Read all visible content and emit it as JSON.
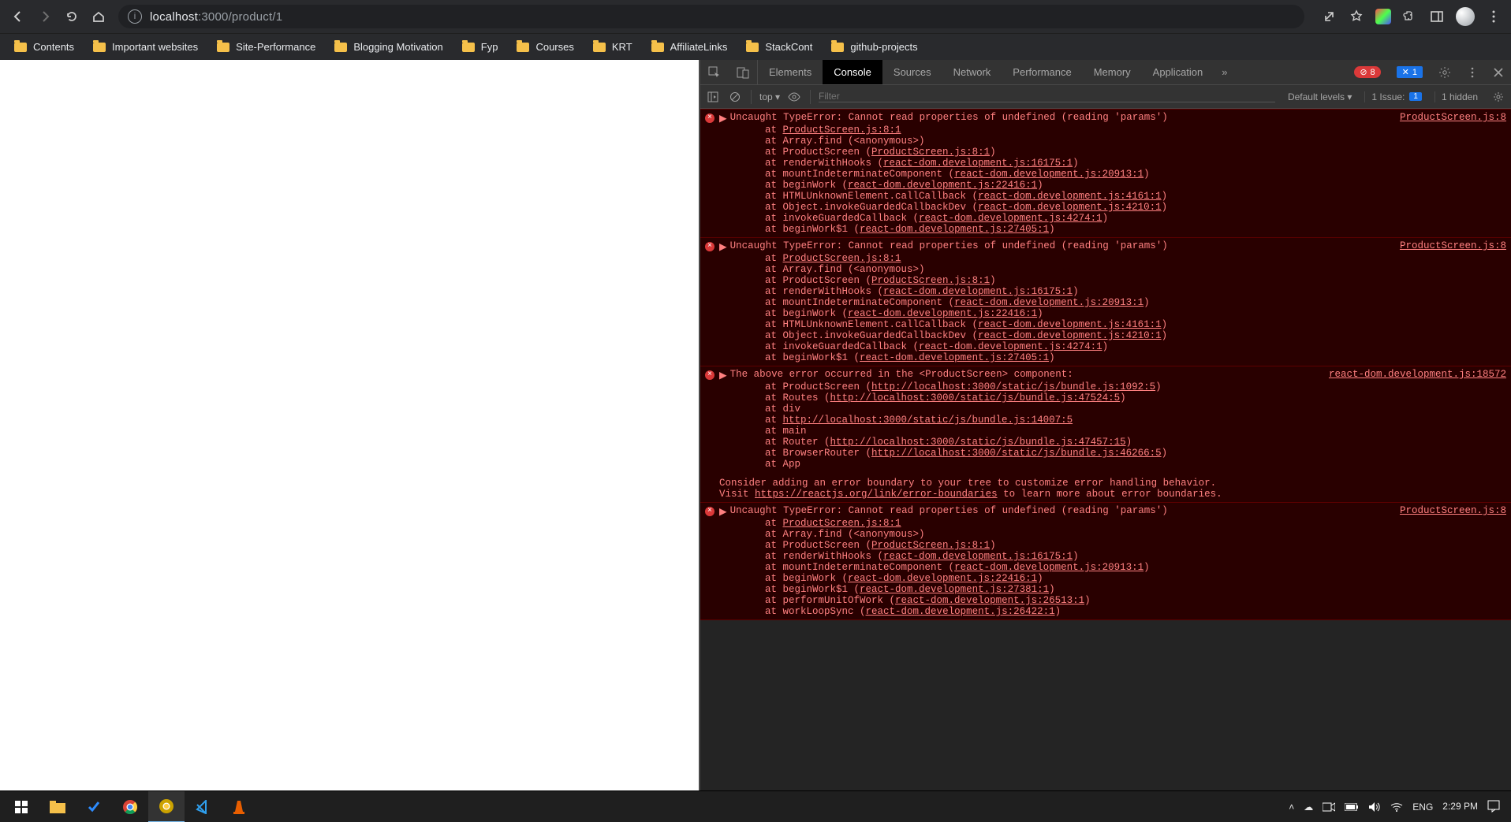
{
  "browser": {
    "url_prefix": "localhost",
    "url_port": ":3000",
    "url_path": "/product/1"
  },
  "bookmarks": [
    {
      "label": "Contents"
    },
    {
      "label": "Important websites"
    },
    {
      "label": "Site-Performance"
    },
    {
      "label": "Blogging Motivation"
    },
    {
      "label": "Fyp"
    },
    {
      "label": "Courses"
    },
    {
      "label": "KRT"
    },
    {
      "label": "AffiliateLinks"
    },
    {
      "label": "StackCont"
    },
    {
      "label": "github-projects"
    }
  ],
  "devtools": {
    "tabs": [
      "Elements",
      "Console",
      "Sources",
      "Network",
      "Performance",
      "Memory",
      "Application"
    ],
    "active_tab": "Console",
    "err_count": "8",
    "info_count": "1",
    "toolbar": {
      "context": "top ▾",
      "filter_placeholder": "Filter",
      "levels": "Default levels ▾",
      "issues_label": "1 Issue:",
      "issues_badge": "1",
      "hidden": "1 hidden"
    },
    "messages": [
      {
        "head": "Uncaught TypeError: Cannot read properties of undefined (reading 'params')",
        "src": "ProductScreen.js:8",
        "trace": [
          {
            "pre": "    at ",
            "fn": "",
            "ul": "ProductScreen.js:8:1",
            "post": ""
          },
          {
            "pre": "    at ",
            "fn": "Array.find (<anonymous>)",
            "ul": "",
            "post": ""
          },
          {
            "pre": "    at ",
            "fn": "ProductScreen (",
            "ul": "ProductScreen.js:8:1",
            "post": ")"
          },
          {
            "pre": "    at ",
            "fn": "renderWithHooks (",
            "ul": "react-dom.development.js:16175:1",
            "post": ")"
          },
          {
            "pre": "    at ",
            "fn": "mountIndeterminateComponent (",
            "ul": "react-dom.development.js:20913:1",
            "post": ")"
          },
          {
            "pre": "    at ",
            "fn": "beginWork (",
            "ul": "react-dom.development.js:22416:1",
            "post": ")"
          },
          {
            "pre": "    at ",
            "fn": "HTMLUnknownElement.callCallback (",
            "ul": "react-dom.development.js:4161:1",
            "post": ")"
          },
          {
            "pre": "    at ",
            "fn": "Object.invokeGuardedCallbackDev (",
            "ul": "react-dom.development.js:4210:1",
            "post": ")"
          },
          {
            "pre": "    at ",
            "fn": "invokeGuardedCallback (",
            "ul": "react-dom.development.js:4274:1",
            "post": ")"
          },
          {
            "pre": "    at ",
            "fn": "beginWork$1 (",
            "ul": "react-dom.development.js:27405:1",
            "post": ")"
          }
        ]
      },
      {
        "head": "Uncaught TypeError: Cannot read properties of undefined (reading 'params')",
        "src": "ProductScreen.js:8",
        "trace": [
          {
            "pre": "    at ",
            "fn": "",
            "ul": "ProductScreen.js:8:1",
            "post": ""
          },
          {
            "pre": "    at ",
            "fn": "Array.find (<anonymous>)",
            "ul": "",
            "post": ""
          },
          {
            "pre": "    at ",
            "fn": "ProductScreen (",
            "ul": "ProductScreen.js:8:1",
            "post": ")"
          },
          {
            "pre": "    at ",
            "fn": "renderWithHooks (",
            "ul": "react-dom.development.js:16175:1",
            "post": ")"
          },
          {
            "pre": "    at ",
            "fn": "mountIndeterminateComponent (",
            "ul": "react-dom.development.js:20913:1",
            "post": ")"
          },
          {
            "pre": "    at ",
            "fn": "beginWork (",
            "ul": "react-dom.development.js:22416:1",
            "post": ")"
          },
          {
            "pre": "    at ",
            "fn": "HTMLUnknownElement.callCallback (",
            "ul": "react-dom.development.js:4161:1",
            "post": ")"
          },
          {
            "pre": "    at ",
            "fn": "Object.invokeGuardedCallbackDev (",
            "ul": "react-dom.development.js:4210:1",
            "post": ")"
          },
          {
            "pre": "    at ",
            "fn": "invokeGuardedCallback (",
            "ul": "react-dom.development.js:4274:1",
            "post": ")"
          },
          {
            "pre": "    at ",
            "fn": "beginWork$1 (",
            "ul": "react-dom.development.js:27405:1",
            "post": ")"
          }
        ]
      },
      {
        "head": "The above error occurred in the <ProductScreen> component:",
        "src": "react-dom.development.js:18572",
        "trace": [
          {
            "pre": "",
            "fn": "",
            "ul": "",
            "post": ""
          },
          {
            "pre": "    at ",
            "fn": "ProductScreen (",
            "ul": "http://localhost:3000/static/js/bundle.js:1092:5",
            "post": ")"
          },
          {
            "pre": "    at ",
            "fn": "Routes (",
            "ul": "http://localhost:3000/static/js/bundle.js:47524:5",
            "post": ")"
          },
          {
            "pre": "    at ",
            "fn": "div",
            "ul": "",
            "post": ""
          },
          {
            "pre": "    at ",
            "fn": "",
            "ul": "http://localhost:3000/static/js/bundle.js:14007:5",
            "post": ""
          },
          {
            "pre": "    at ",
            "fn": "main",
            "ul": "",
            "post": ""
          },
          {
            "pre": "    at ",
            "fn": "Router (",
            "ul": "http://localhost:3000/static/js/bundle.js:47457:15",
            "post": ")"
          },
          {
            "pre": "    at ",
            "fn": "BrowserRouter (",
            "ul": "http://localhost:3000/static/js/bundle.js:46266:5",
            "post": ")"
          },
          {
            "pre": "    at ",
            "fn": "App",
            "ul": "",
            "post": ""
          }
        ],
        "extra": [
          "Consider adding an error boundary to your tree to customize error handling behavior.",
          {
            "pre": "Visit ",
            "ul": "https://reactjs.org/link/error-boundaries",
            "post": " to learn more about error boundaries."
          }
        ]
      },
      {
        "head": "Uncaught TypeError: Cannot read properties of undefined (reading 'params')",
        "src": "ProductScreen.js:8",
        "trace": [
          {
            "pre": "    at ",
            "fn": "",
            "ul": "ProductScreen.js:8:1",
            "post": ""
          },
          {
            "pre": "    at ",
            "fn": "Array.find (<anonymous>)",
            "ul": "",
            "post": ""
          },
          {
            "pre": "    at ",
            "fn": "ProductScreen (",
            "ul": "ProductScreen.js:8:1",
            "post": ")"
          },
          {
            "pre": "    at ",
            "fn": "renderWithHooks (",
            "ul": "react-dom.development.js:16175:1",
            "post": ")"
          },
          {
            "pre": "    at ",
            "fn": "mountIndeterminateComponent (",
            "ul": "react-dom.development.js:20913:1",
            "post": ")"
          },
          {
            "pre": "    at ",
            "fn": "beginWork (",
            "ul": "react-dom.development.js:22416:1",
            "post": ")"
          },
          {
            "pre": "    at ",
            "fn": "beginWork$1 (",
            "ul": "react-dom.development.js:27381:1",
            "post": ")"
          },
          {
            "pre": "    at ",
            "fn": "performUnitOfWork (",
            "ul": "react-dom.development.js:26513:1",
            "post": ")"
          },
          {
            "pre": "    at ",
            "fn": "workLoopSync (",
            "ul": "react-dom.development.js:26422:1",
            "post": ")"
          }
        ]
      }
    ]
  },
  "taskbar": {
    "lang": "ENG",
    "time": "2:29 PM"
  }
}
